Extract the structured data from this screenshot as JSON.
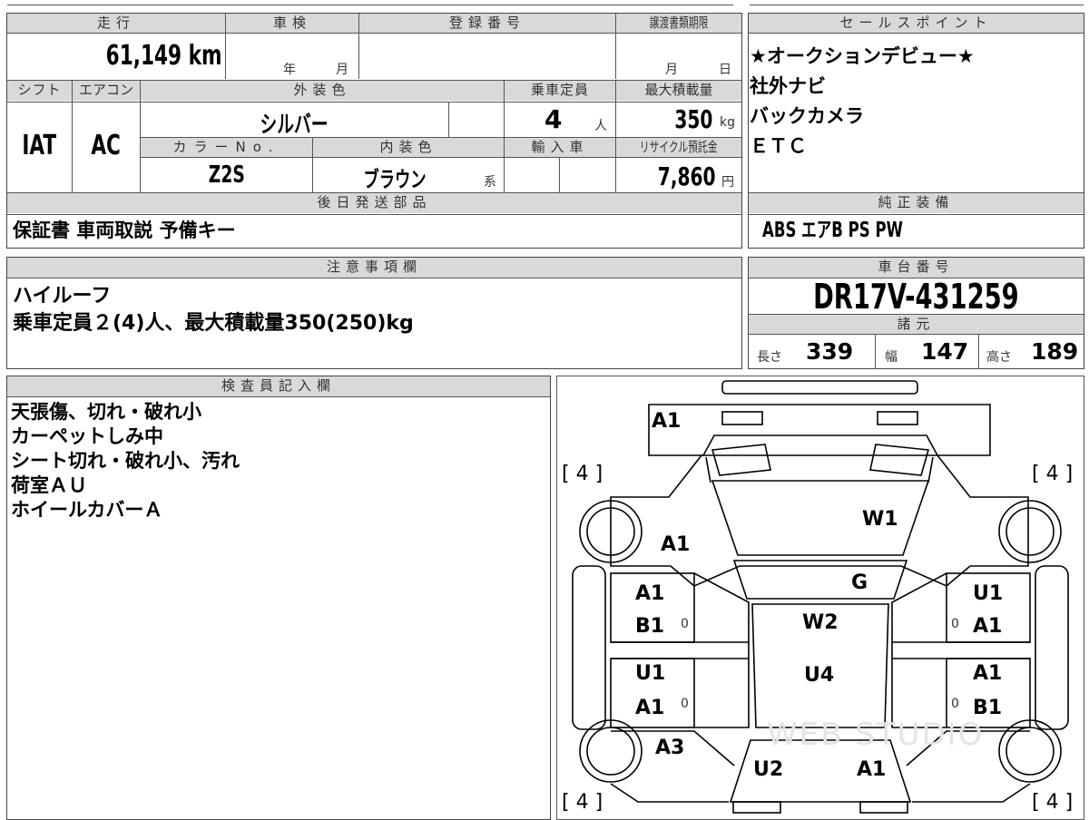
{
  "header": {
    "mileage": "走行",
    "inspection": "車検",
    "registration": "登録番号",
    "transfer_deadline": "譲渡書類期限",
    "sales_points": "セールスポイント",
    "shift": "シフト",
    "aircon": "エアコン",
    "exterior_color": "外装色",
    "capacity": "乗車定員",
    "max_load": "最大積載量",
    "color_no": "カラーNo.",
    "interior_color": "内装色",
    "import": "輸入車",
    "recycle": "リサイクル預託金",
    "later_parts": "後日発送部品",
    "genuine_equipment": "純正装備",
    "notes": "注意事項欄",
    "chassis_no": "車台番号",
    "specs": "諸元",
    "inspector": "検査員記入欄"
  },
  "vehicle": {
    "mileage_value": "61,149",
    "mileage_unit": "km",
    "inspection_year": "年",
    "inspection_month": "月",
    "transfer_month": "月",
    "transfer_day": "日",
    "shift_value": "IAT",
    "aircon_value": "AC",
    "exterior_color_value": "シルバー",
    "capacity_value": "4",
    "capacity_unit": "人",
    "max_load_value": "350",
    "max_load_unit": "kg",
    "color_no_value": "Z2S",
    "interior_color_value": "ブラウン",
    "interior_suffix": "系",
    "recycle_value": "7,860",
    "recycle_unit": "円",
    "later_parts_value": "保証書 車両取説 予備キー",
    "genuine_equipment_value": "ABS エアB PS PW",
    "chassis_no_value": "DR17V-431259",
    "length_label": "長さ",
    "length_value": "339",
    "width_label": "幅",
    "width_value": "147",
    "height_label": "高さ",
    "height_value": "189"
  },
  "sales_points": [
    "★オークションデビュー★",
    "社外ナビ",
    "バックカメラ",
    "ＥＴＣ"
  ],
  "notes": [
    "ハイルーフ",
    "乗車定員２(4)人、最大積載量350(250)kg"
  ],
  "inspector_notes": [
    "天張傷、切れ・破れ小",
    "カーペットしみ中",
    "シート切れ・破れ小、汚れ",
    "荷室ＡＵ",
    "ホイールカバーＡ"
  ],
  "diagram": {
    "tire_fl": "[ 4 ]",
    "tire_fr": "[ 4 ]",
    "tire_rl": "[ 4 ]",
    "tire_rr": "[ 4 ]",
    "rear_a1": "A1",
    "w1": "W1",
    "left_a1": "A1",
    "g": "G",
    "lr_a1": "A1",
    "lr_b1": "B1",
    "w2": "W2",
    "rr_u1": "U1",
    "rr_a1": "A1",
    "lf_u1": "U1",
    "lf_a1": "A1",
    "u4": "U4",
    "rf_a1": "A1",
    "rf_b1": "B1",
    "a3": "A3",
    "u2": "U2",
    "front_a1": "A1",
    "mark0": "0"
  },
  "watermark": "WEB STUDIO"
}
